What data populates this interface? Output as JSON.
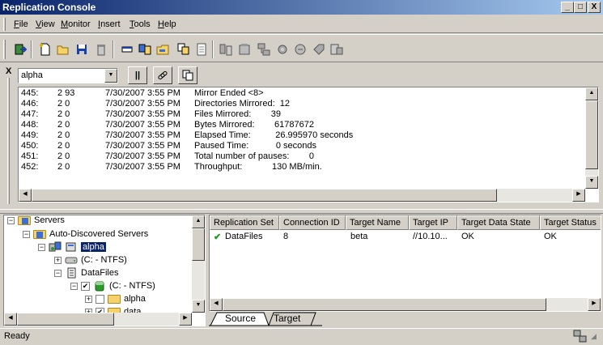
{
  "window": {
    "title": "Replication Console",
    "minimize": "_",
    "maximize": "□",
    "close": "X"
  },
  "menu": [
    {
      "u": "F",
      "rest": "ile"
    },
    {
      "u": "V",
      "rest": "iew"
    },
    {
      "u": "M",
      "rest": "onitor"
    },
    {
      "u": "I",
      "rest": "nsert"
    },
    {
      "u": "T",
      "rest": "ools"
    },
    {
      "u": "H",
      "rest": "elp"
    }
  ],
  "toolbar": {
    "icons": [
      "exit-icon",
      "new-icon",
      "open-icon",
      "save-icon",
      "delete-icon",
      "properties-icon",
      "monitor-icon",
      "folder-icon",
      "copy-icon",
      "list-icon",
      "mirror-icon",
      "replicate-icon",
      "network-icon",
      "settings-icon",
      "cycle-icon",
      "tag-icon",
      "report-icon"
    ]
  },
  "monitor": {
    "close_label": "X",
    "server_select": "alpha",
    "pause_label": "||",
    "log": [
      {
        "id": "445:",
        "code": "2 93",
        "date": "7/30/2007 3:55 PM",
        "msg": "Mirror Ended <8>"
      },
      {
        "id": "446:",
        "code": "2 0",
        "date": "7/30/2007 3:55 PM",
        "msg": "Directories Mirrored:  12"
      },
      {
        "id": "447:",
        "code": "2 0",
        "date": "7/30/2007 3:55 PM",
        "msg": "Files Mirrored:        39"
      },
      {
        "id": "448:",
        "code": "2 0",
        "date": "7/30/2007 3:55 PM",
        "msg": "Bytes Mirrored:        61787672"
      },
      {
        "id": "449:",
        "code": "2 0",
        "date": "7/30/2007 3:55 PM",
        "msg": "Elapsed Time:          26.995970 seconds"
      },
      {
        "id": "450:",
        "code": "2 0",
        "date": "7/30/2007 3:55 PM",
        "msg": "Paused Time:           0 seconds"
      },
      {
        "id": "451:",
        "code": "2 0",
        "date": "7/30/2007 3:55 PM",
        "msg": "Total number of pauses:        0"
      },
      {
        "id": "452:",
        "code": "2 0",
        "date": "7/30/2007 3:55 PM",
        "msg": "Throughput:            130 MB/min."
      }
    ]
  },
  "tree": {
    "servers": "Servers",
    "auto_discovered": "Auto-Discovered Servers",
    "alpha": "alpha",
    "c_ntfs": "(C: - NTFS)",
    "datafiles": "DataFiles",
    "c_ntfs_checked": "(C: - NTFS)",
    "folder_alpha": "alpha",
    "folder_data": "data"
  },
  "grid": {
    "columns": [
      "Replication Set",
      "Connection ID",
      "Target Name",
      "Target IP",
      "Target Data State",
      "Target Status"
    ],
    "rows": [
      {
        "set": "DataFiles",
        "conn": "8",
        "target": "beta",
        "ip": "//10.10...",
        "state": "OK",
        "status": "OK"
      }
    ]
  },
  "tabs": {
    "source": "Source",
    "target": "Target"
  },
  "status": {
    "text": "Ready"
  },
  "colors": {
    "title_start": "#0a246a",
    "title_end": "#a6caf0",
    "face": "#d4d0c8",
    "selection": "#0a246a",
    "check": "#1a9a1a"
  }
}
